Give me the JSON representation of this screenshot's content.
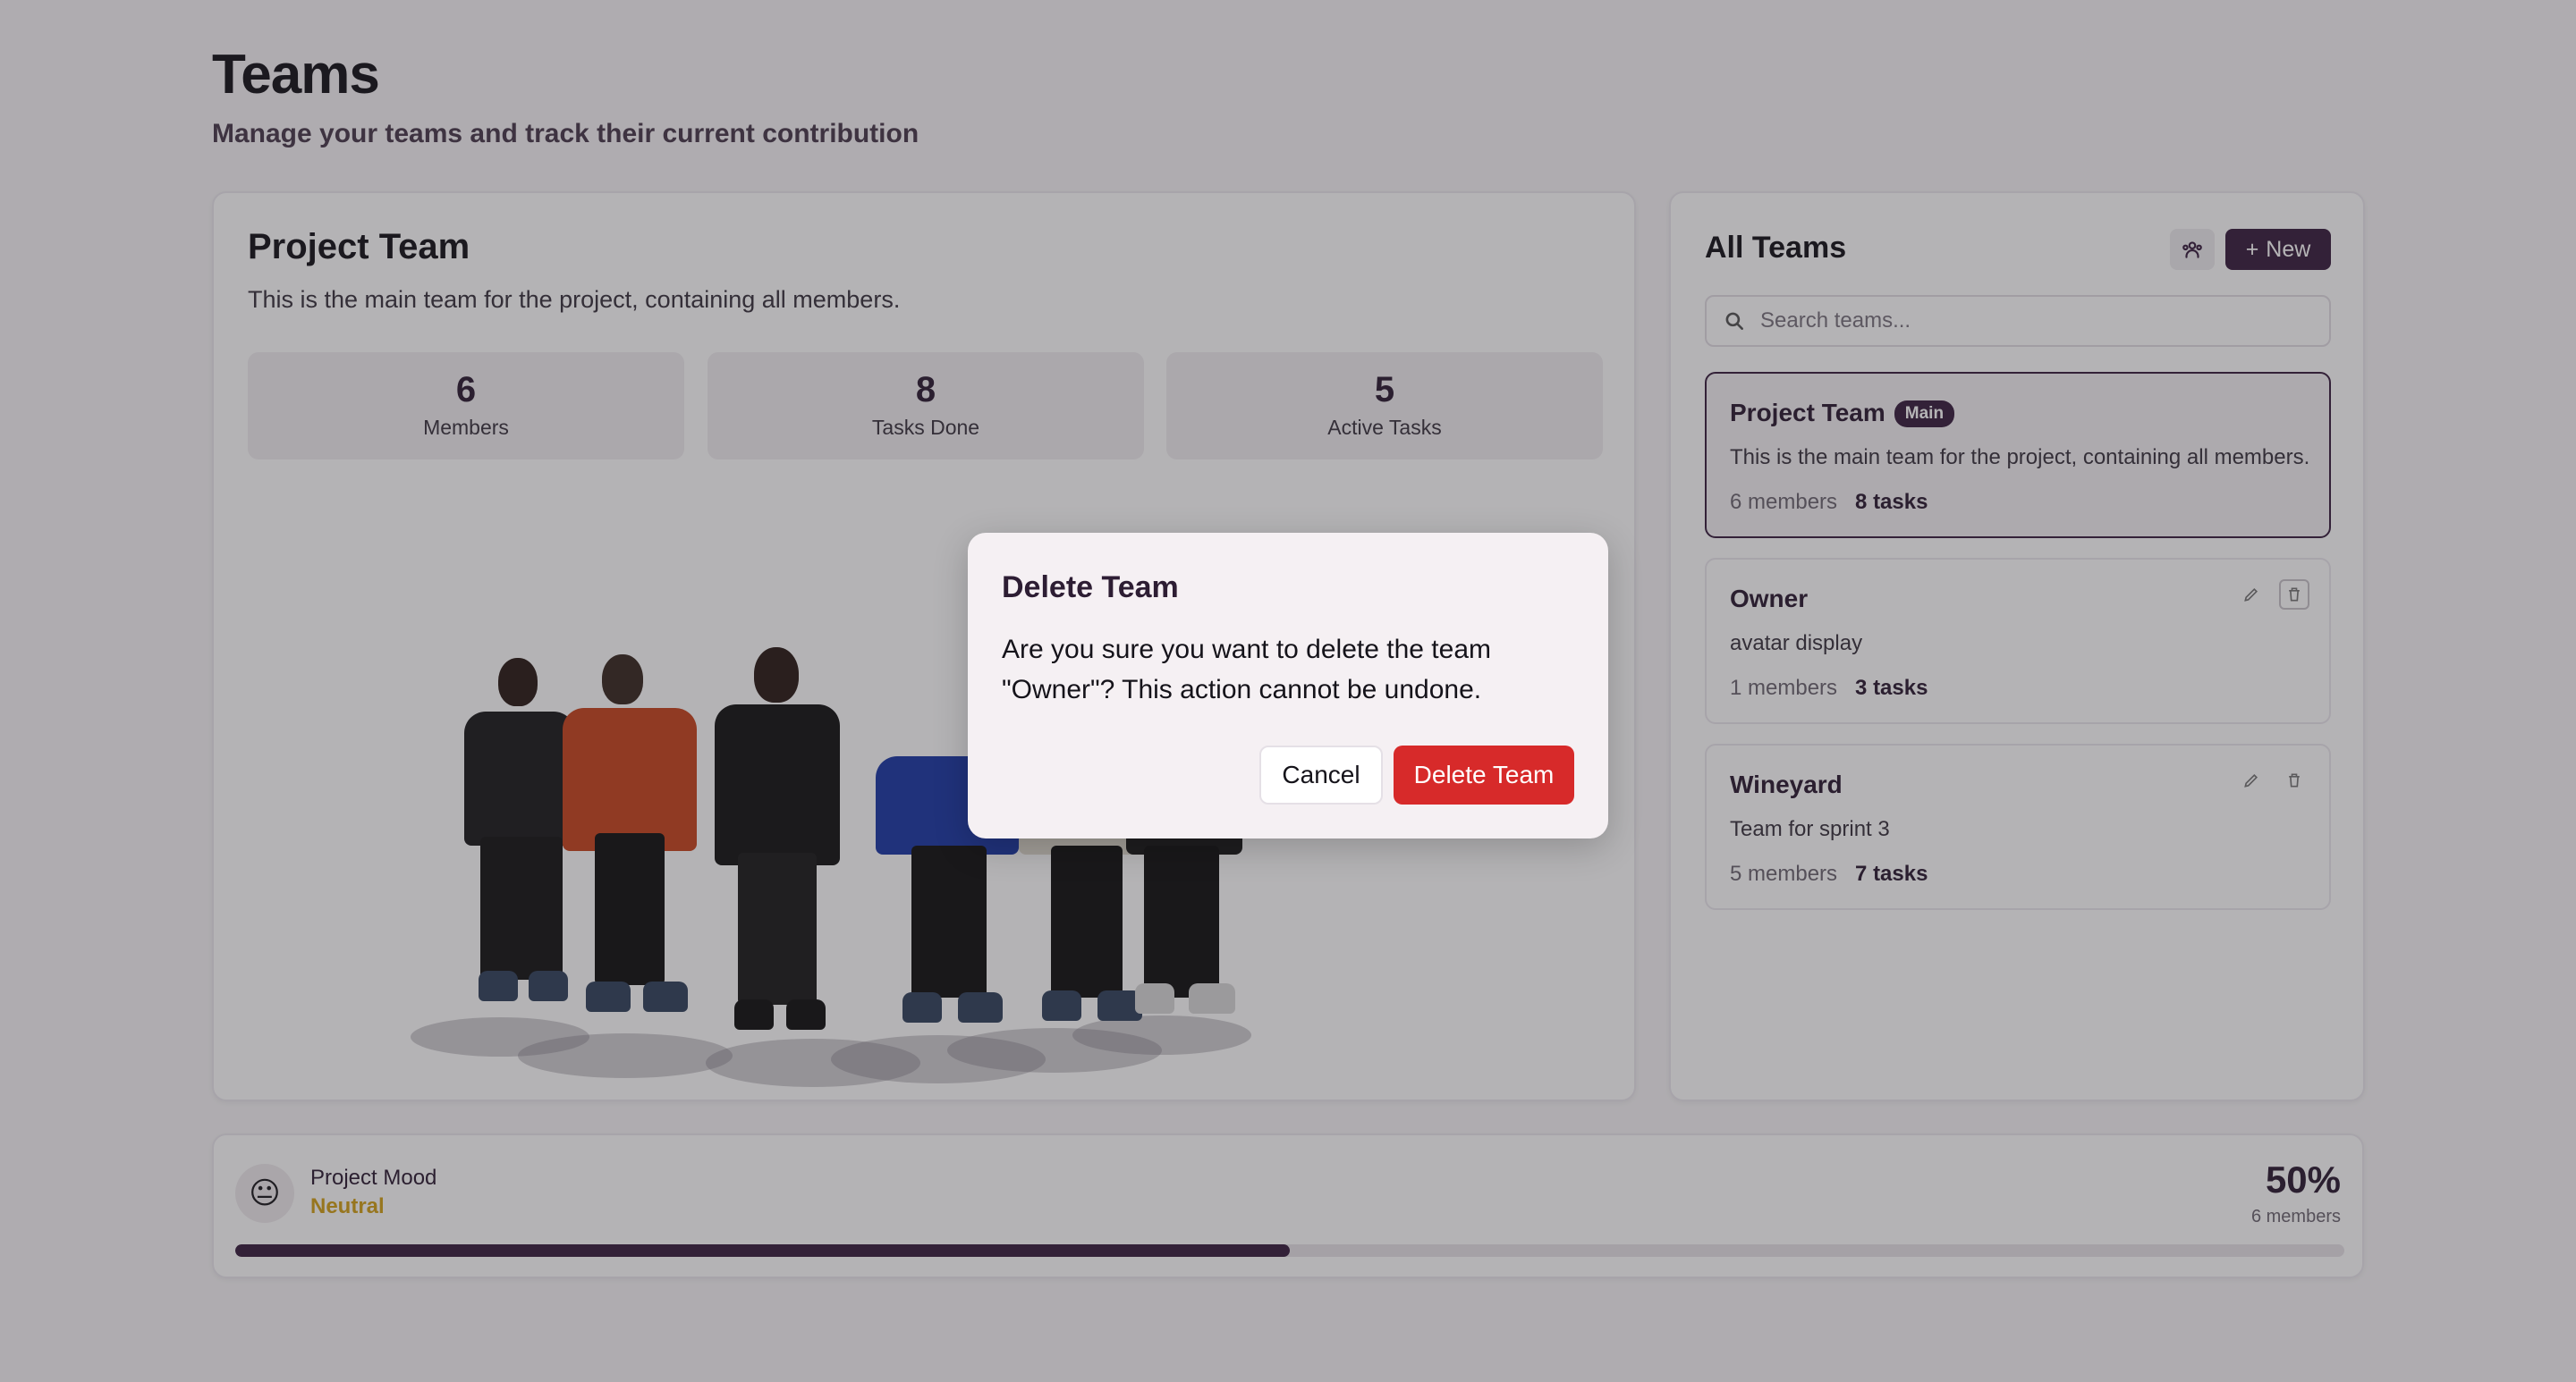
{
  "header": {
    "title": "Teams",
    "subtitle": "Manage your teams and track their current contribution"
  },
  "project": {
    "title": "Project Team",
    "description": "This is the main team for the project, containing all members.",
    "stats": [
      {
        "value": "6",
        "label": "Members"
      },
      {
        "value": "8",
        "label": "Tasks Done"
      },
      {
        "value": "5",
        "label": "Active Tasks"
      }
    ]
  },
  "all_teams": {
    "title": "All Teams",
    "new_label": "New",
    "search_placeholder": "Search teams...",
    "items": [
      {
        "name": "Project Team",
        "badge": "Main",
        "description": "This is the main team for the project, containing all members.",
        "members": "6 members",
        "tasks": "8 tasks"
      },
      {
        "name": "Owner",
        "description": "avatar display",
        "members": "1 members",
        "tasks": "3 tasks"
      },
      {
        "name": "Wineyard",
        "description": "Team for sprint 3",
        "members": "5 members",
        "tasks": "7 tasks"
      }
    ]
  },
  "mood": {
    "emoji": "😐",
    "label": "Project Mood",
    "value": "Neutral",
    "percent": "50%",
    "members": "6 members",
    "progress": 0.5
  },
  "dialog": {
    "title": "Delete Team",
    "message": "Are you sure you want to delete the team \"Owner\"? This action cannot be undone.",
    "cancel_label": "Cancel",
    "delete_label": "Delete Team"
  },
  "colors": {
    "accent": "#3a1f3f",
    "danger": "#d72a2a",
    "mood": "#d3a21a"
  }
}
